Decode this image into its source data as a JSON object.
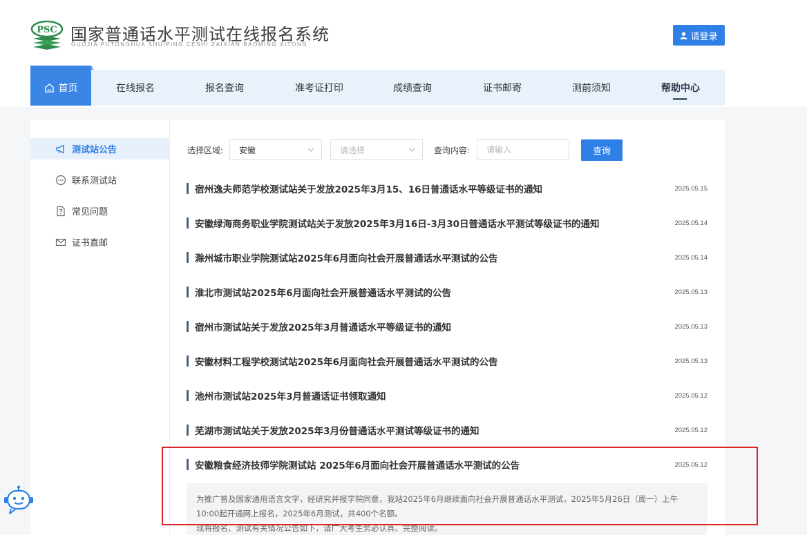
{
  "header": {
    "logo_text": "PSC",
    "title": "国家普通话水平测试在线报名系统",
    "subtitle": "GUOJIA PUTONGHUA SHUIPING CESHI ZAIXIAN BAOMING XITONG",
    "login_label": "请登录",
    "accent_color": "#2f80e6"
  },
  "nav": {
    "items": [
      {
        "label": "首页",
        "icon": "home-icon"
      },
      {
        "label": "在线报名"
      },
      {
        "label": "报名查询"
      },
      {
        "label": "准考证打印"
      },
      {
        "label": "成绩查询"
      },
      {
        "label": "证书邮寄"
      },
      {
        "label": "测前须知"
      },
      {
        "label": "帮助中心"
      }
    ],
    "active": "首页"
  },
  "sidebar": {
    "items": [
      {
        "label": "测试站公告",
        "icon": "megaphone-icon"
      },
      {
        "label": "联系测试站",
        "icon": "chat-icon"
      },
      {
        "label": "常见问题",
        "icon": "question-doc-icon"
      },
      {
        "label": "证书直邮",
        "icon": "mail-icon"
      }
    ],
    "active": "测试站公告"
  },
  "filters": {
    "region_label": "选择区域:",
    "province_value": "安徽",
    "city_placeholder": "请选择",
    "query_label": "查询内容:",
    "query_placeholder": "请输入",
    "query_button": "查询"
  },
  "notices": [
    {
      "title": "宿州逸夫师范学校测试站关于发放2025年3月15、16日普通话水平等级证书的通知",
      "date": "2025.05.15"
    },
    {
      "title": "安徽绿海商务职业学院测试站关于发放2025年3月16日-3月30日普通话水平测试等级证书的通知",
      "date": "2025.05.14"
    },
    {
      "title": "滁州城市职业学院测试站2025年6月面向社会开展普通话水平测试的公告",
      "date": "2025.05.14"
    },
    {
      "title": "淮北市测试站2025年6月面向社会开展普通话水平测试的公告",
      "date": "2025.05.13"
    },
    {
      "title": "宿州市测试站关于发放2025年3月普通话水平等级证书的通知",
      "date": "2025.05.13"
    },
    {
      "title": "安徽材料工程学校测试站2025年6月面向社会开展普通话水平测试的公告",
      "date": "2025.05.13"
    },
    {
      "title": "池州市测试站2025年3月普通话证书领取通知",
      "date": "2025.05.12"
    },
    {
      "title": "芜湖市测试站关于发放2025年3月份普通话水平测试等级证书的通知",
      "date": "2025.05.12"
    },
    {
      "title": "安徽粮食经济技师学院测试站 2025年6月面向社会开展普通话水平测试的公告",
      "date": "2025.05.12"
    }
  ],
  "summary": {
    "lines": [
      "为推广普及国家通用语言文字，经研究并报学院同意，我站2025年6月继续面向社会开展普通话水平测试，2025年5月26日（周一）上午",
      "10:00起开通网上报名，2025年6月测试，共400个名额。",
      "现将报名、测试有关情况公告如下，请广大考生务必认真、完整阅读。"
    ]
  },
  "colors": {
    "highlight_border": "#d9262a",
    "nav_bg": "#e9f1fb",
    "active_tab_bg": "#3b85e4"
  }
}
